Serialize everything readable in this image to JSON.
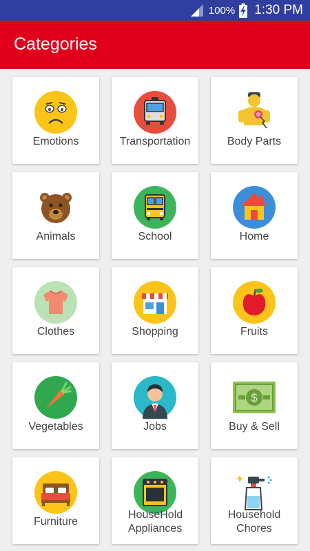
{
  "status_bar": {
    "battery": "100%",
    "time": "1:30 PM"
  },
  "app_bar": {
    "title": "Categories"
  },
  "categories": [
    {
      "label": "Emotions",
      "icon": "sad-face-icon",
      "color": "#fcc419"
    },
    {
      "label": "Transportation",
      "icon": "bus-icon",
      "color": "#e74c3c"
    },
    {
      "label": "Body Parts",
      "icon": "body-parts-icon",
      "color": "#f4c430"
    },
    {
      "label": "Animals",
      "icon": "bear-icon",
      "color": "#8d5524"
    },
    {
      "label": "School",
      "icon": "school-bus-icon",
      "color": "#3cb55a"
    },
    {
      "label": "Home",
      "icon": "house-icon",
      "color": "#3b8fd9"
    },
    {
      "label": "Clothes",
      "icon": "shirt-icon",
      "color": "#b9e3b4"
    },
    {
      "label": "Shopping",
      "icon": "store-icon",
      "color": "#fcc419"
    },
    {
      "label": "Fruits",
      "icon": "apple-icon",
      "color": "#fcc419"
    },
    {
      "label": "Vegetables",
      "icon": "carrot-icon",
      "color": "#2fa84f"
    },
    {
      "label": "Jobs",
      "icon": "businessman-icon",
      "color": "#2bb8c8"
    },
    {
      "label": "Buy & Sell",
      "icon": "money-icon",
      "color": "#8bc34a"
    },
    {
      "label": "Furniture",
      "icon": "bed-icon",
      "color": "#fcc419"
    },
    {
      "label": "HouseHold Appliances",
      "icon": "oven-icon",
      "color": "#3cb55a"
    },
    {
      "label": "Household Chores",
      "icon": "spray-bottle-icon",
      "color": "#ffffff"
    }
  ]
}
